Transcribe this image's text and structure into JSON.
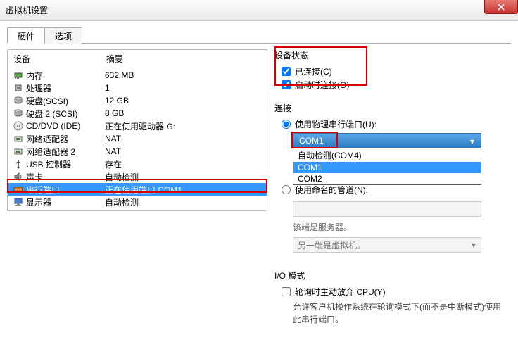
{
  "window": {
    "title": "虚拟机设置"
  },
  "tabs": [
    "硬件",
    "选项"
  ],
  "device_list": {
    "headers": {
      "device": "设备",
      "summary": "摘要"
    },
    "rows": [
      {
        "icon": "memory-icon",
        "name": "内存",
        "summary": "632 MB"
      },
      {
        "icon": "cpu-icon",
        "name": "处理器",
        "summary": "1"
      },
      {
        "icon": "disk-icon",
        "name": "硬盘(SCSI)",
        "summary": "12 GB"
      },
      {
        "icon": "disk-icon",
        "name": "硬盘 2 (SCSI)",
        "summary": "8 GB"
      },
      {
        "icon": "cd-icon",
        "name": "CD/DVD (IDE)",
        "summary": "正在使用驱动器 G:"
      },
      {
        "icon": "nic-icon",
        "name": "网络适配器",
        "summary": "NAT"
      },
      {
        "icon": "nic-icon",
        "name": "网络适配器 2",
        "summary": "NAT"
      },
      {
        "icon": "usb-icon",
        "name": "USB 控制器",
        "summary": "存在"
      },
      {
        "icon": "sound-icon",
        "name": "声卡",
        "summary": "自动检测"
      },
      {
        "icon": "serial-icon",
        "name": "串行端口",
        "summary": "正在使用端口 COM1",
        "selected": true
      },
      {
        "icon": "display-icon",
        "name": "显示器",
        "summary": "自动检测"
      }
    ]
  },
  "status": {
    "title": "设备状态",
    "connected": "已连接(C)",
    "connect_on_power": "启动时连接(O)"
  },
  "connection": {
    "title": "连接",
    "physical": "使用物理串行端口(U):",
    "port_value": "COM1",
    "options": [
      "自动检测(COM4)",
      "COM1",
      "COM2"
    ],
    "named_pipe": "使用命名的管道(N):",
    "hint_server": "该端是服务器。",
    "other_end": "另一端是虚拟机。"
  },
  "io": {
    "title": "I/O 模式",
    "yield_cpu": "轮询时主动放弃 CPU(Y)",
    "desc": "允许客户机操作系统在轮询模式下(而不是中断模式)使用此串行端口。"
  },
  "icons": {
    "memory-icon": "<rect x='3' y='5' width='10' height='6' fill='#5a9e4a' stroke='#2d5a20'/><rect x='4' y='11' width='1' height='2' fill='#888'/><rect x='6' y='11' width='1' height='2' fill='#888'/><rect x='8' y='11' width='1' height='2' fill='#888'/><rect x='10' y='11' width='1' height='2' fill='#888'/>",
    "cpu-icon": "<rect x='4' y='4' width='8' height='8' fill='#bbb' stroke='#555'/><rect x='6' y='6' width='4' height='4' fill='#777'/>",
    "disk-icon": "<ellipse cx='8' cy='5' rx='5' ry='2' fill='#ccc' stroke='#666'/><path d='M3 5 V10 A5 2 0 0 0 13 10 V5' fill='#aaa' stroke='#666'/>",
    "cd-icon": "<circle cx='8' cy='8' r='6' fill='#e8e8e8' stroke='#888'/><circle cx='8' cy='8' r='1.5' fill='#fff' stroke='#888'/>",
    "nic-icon": "<rect x='3' y='5' width='10' height='7' fill='#d0d0d0' stroke='#666'/><rect x='5' y='7' width='6' height='3' fill='#4a7a3a'/>",
    "usb-icon": "<path d='M8 2 V13 M8 5 L5 7 M8 5 L11 7' stroke='#333' stroke-width='1.4' fill='none'/><circle cx='8' cy='13' r='1.5' fill='#333'/>",
    "sound-icon": "<path d='M3 6 H5 L9 3 V13 L5 10 H3 Z' fill='#888' stroke='#555'/><path d='M11 5 Q13 8 11 11' stroke='#555' fill='none'/>",
    "serial-icon": "<rect x='2' y='5' width='12' height='6' rx='1' fill='#c97a2a' stroke='#7a4a10'/><circle cx='5' cy='8' r='0.8' fill='#fff'/><circle cx='8' cy='8' r='0.8' fill='#fff'/><circle cx='11' cy='8' r='0.8' fill='#fff'/>",
    "display-icon": "<rect x='3' y='3' width='10' height='7' fill='#4a7ac8' stroke='#2a4a88'/><rect x='6' y='10' width='4' height='2' fill='#888'/><rect x='4' y='12' width='8' height='1' fill='#888'/>"
  }
}
